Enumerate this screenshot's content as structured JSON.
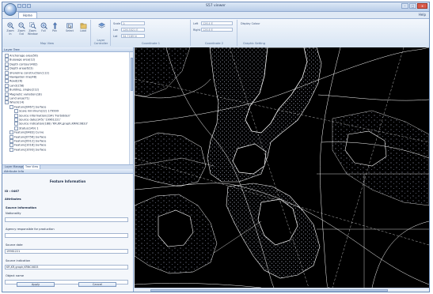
{
  "window": {
    "title": "S57 viewer",
    "controls": {
      "minimize": "–",
      "maximize": "□",
      "close": "x"
    }
  },
  "ribbon": {
    "tabs": [
      {
        "label": "Home",
        "active": true
      }
    ],
    "help_label": "Help",
    "toolbar_buttons": [
      {
        "label": "Zoom In",
        "icon": "zoom-in-icon"
      },
      {
        "label": "Zoom Out",
        "icon": "zoom-out-icon"
      },
      {
        "label": "Zoom Window",
        "icon": "zoom-window-icon"
      },
      {
        "label": "Full",
        "icon": "zoom-full-icon"
      },
      {
        "label": "Pan",
        "icon": "pan-icon"
      },
      {
        "label": "Select",
        "icon": "select-icon"
      },
      {
        "label": "Load",
        "icon": "load-icon"
      }
    ],
    "groups": [
      {
        "label": "Map View"
      },
      {
        "label": "Layer Controller"
      },
      {
        "label": "Coordinate 1"
      },
      {
        "label": "Coordinate 2"
      },
      {
        "label": "Graphic Setting"
      }
    ],
    "coord_fields": [
      {
        "label": "Scale",
        "value": "1:"
      },
      {
        "label": "Lon",
        "value": "126.5021 E"
      },
      {
        "label": "Lat",
        "value": "34.7189 N"
      },
      {
        "label": "Left",
        "value": "126.4 E"
      },
      {
        "label": "Right",
        "value": "126.6 E"
      }
    ],
    "graphic_label": "Display Colour"
  },
  "layer_panel": {
    "header": "Layer Tree",
    "items": [
      {
        "label": "Anchorage area(56)",
        "indent": 0
      },
      {
        "label": "Buoyage area(12)",
        "indent": 0
      },
      {
        "label": "Depth contour(482)",
        "indent": 0
      },
      {
        "label": "Depth area(623)",
        "indent": 0
      },
      {
        "label": "Shoreline construction(112)",
        "indent": 0
      },
      {
        "label": "Navigation line(48)",
        "indent": 0
      },
      {
        "label": "Road(26)",
        "indent": 0
      },
      {
        "label": "Land(158)",
        "indent": 0
      },
      {
        "label": "Building, single(212)",
        "indent": 0
      },
      {
        "label": "Magnetic variation(18)",
        "indent": 0
      },
      {
        "label": "Land area(71)",
        "indent": 0
      },
      {
        "label": "Wreck(14)",
        "indent": 0
      },
      {
        "label": "Feature[0467] Surface",
        "indent": 1
      },
      {
        "label": "Scale minimum(22) 179999",
        "indent": 2
      },
      {
        "label": "Source information(234) 'Forbidden'",
        "indent": 2
      },
      {
        "label": "Source date(145) '19961221'",
        "indent": 2
      },
      {
        "label": "Source indication(188) 'KR,KR,graph,KRNC0833'",
        "indent": 2
      },
      {
        "label": "Status(149) 1",
        "indent": 2
      },
      {
        "label": "Feature[0483] Curve",
        "indent": 1
      },
      {
        "label": "Feature[0756] Surface",
        "indent": 1
      },
      {
        "label": "Feature[0912] Surface",
        "indent": 1
      },
      {
        "label": "Feature[1018] Surface",
        "indent": 1
      },
      {
        "label": "Feature[1093] Surface",
        "indent": 1
      }
    ],
    "tabs": [
      {
        "label": "Layer Manager",
        "active": false
      },
      {
        "label": "Tree View",
        "active": true
      }
    ]
  },
  "feature_info": {
    "header": "Attribute Info",
    "title": "Feature Information",
    "id_label": "ID : 0467",
    "attributes_label": "Attributes",
    "source_info_label": "Source Information",
    "fields": [
      {
        "label": "Nationality",
        "value": ""
      },
      {
        "label": "Agency responsible for production",
        "value": ""
      },
      {
        "label": "Source date",
        "value": "19961221"
      },
      {
        "label": "Source indication",
        "value": "KR,KR,graph,KRNC0833"
      },
      {
        "label": "Object name",
        "value": ""
      }
    ],
    "apply_label": "Apply",
    "cancel_label": "Cancel"
  },
  "colors": {
    "chrome_blue": "#dfe9f5",
    "map_background": "#000000",
    "map_lines": "#ffffff"
  }
}
